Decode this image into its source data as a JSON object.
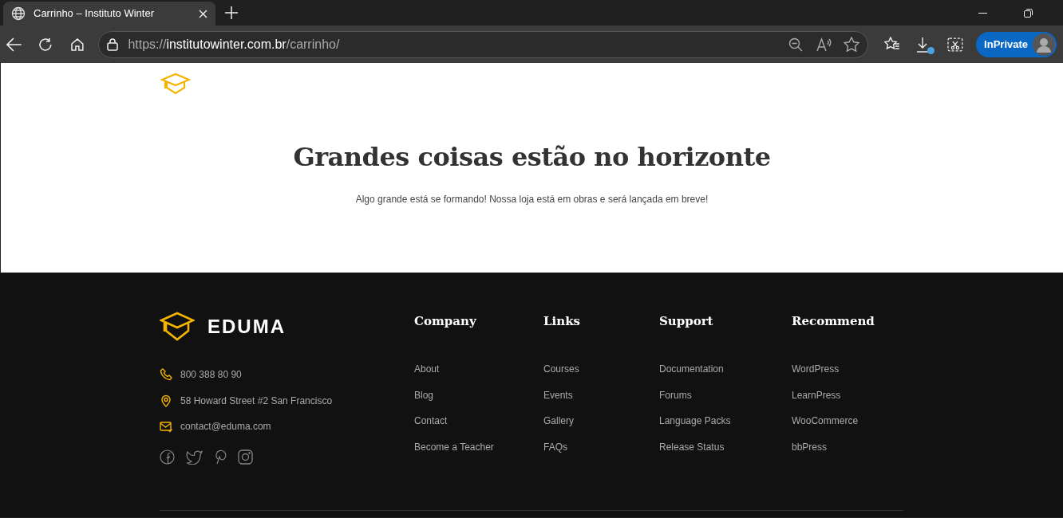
{
  "browser": {
    "tab_title": "Carrinho – Instituto Winter",
    "url": {
      "scheme": "https://",
      "host": "institutowinter.com.br",
      "path": "/carrinho/"
    },
    "profile_label": "InPrivate"
  },
  "page": {
    "heading": "Grandes coisas estão no horizonte",
    "message": "Algo grande está se formando! Nossa loja está em obras e será lançada em breve!"
  },
  "footer": {
    "brand": "EDUMA",
    "contacts": [
      {
        "kind": "phone",
        "text": "800 388 80 90"
      },
      {
        "kind": "location",
        "text": "58 Howard Street #2 San Francisco"
      },
      {
        "kind": "email",
        "text": "contact@eduma.com"
      }
    ],
    "columns": [
      {
        "title": "Company",
        "links": [
          "About",
          "Blog",
          "Contact",
          "Become a Teacher"
        ]
      },
      {
        "title": "Links",
        "links": [
          "Courses",
          "Events",
          "Gallery",
          "FAQs"
        ]
      },
      {
        "title": "Support",
        "links": [
          "Documentation",
          "Forums",
          "Language Packs",
          "Release Status"
        ]
      },
      {
        "title": "Recommend",
        "links": [
          "WordPress",
          "LearnPress",
          "WooCommerce",
          "bbPress"
        ]
      }
    ]
  }
}
